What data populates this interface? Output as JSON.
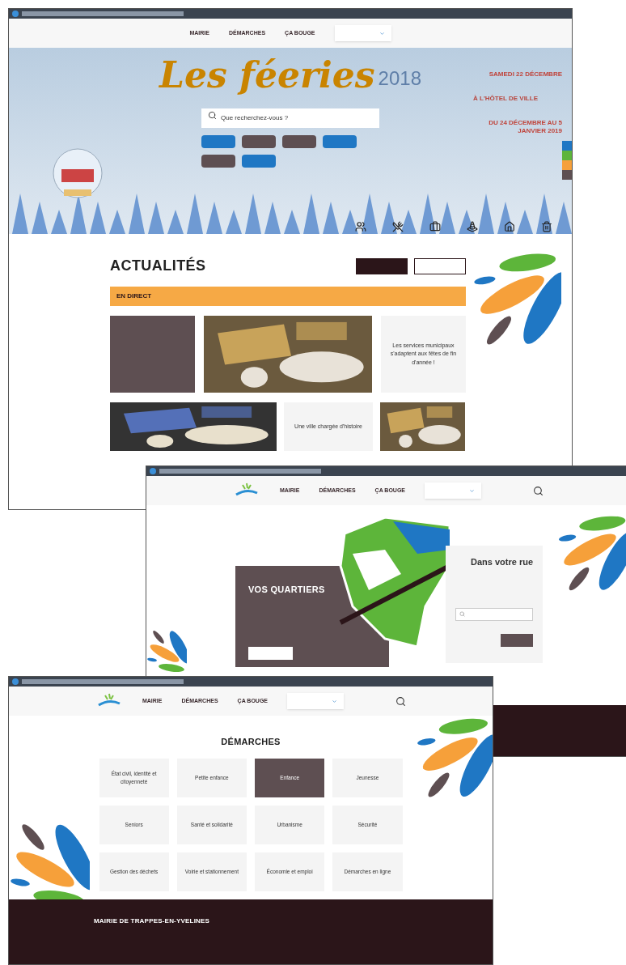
{
  "home_window": {
    "nav": [
      {
        "label": "MAIRIE"
      },
      {
        "label": "DÉMARCHES"
      },
      {
        "label": "ÇA BOUGE"
      }
    ],
    "banner": {
      "title": "Les féeries",
      "year": "2018",
      "search_placeholder": "Que recherchez-vous ?",
      "quick_buttons": [
        {
          "color": "#1f77c4"
        },
        {
          "color": "#5e4f52"
        },
        {
          "color": "#5e4f52"
        },
        {
          "color": "#1f77c4"
        },
        {
          "color": "#5e4f52"
        },
        {
          "color": "#1f77c4"
        }
      ],
      "events": [
        {
          "kind": "date",
          "text": "SAMEDI 22 DÉCEMBRE"
        },
        {
          "kind": "place",
          "text": "À L'HÔTEL DE VILLE"
        },
        {
          "kind": "date",
          "text": "DU 24 DÉCEMBRE AU 5 JANVIER 2019"
        }
      ]
    },
    "news": {
      "heading": "ACTUALITÉS",
      "ticker_label": "EN DIRECT",
      "cards": [
        {
          "kind": "dark"
        },
        {
          "kind": "picture"
        },
        {
          "kind": "text",
          "title": "Les services municipaux s'adaptent aux fêtes de fin d'année !"
        },
        {
          "kind": "picture"
        },
        {
          "kind": "text",
          "title": "Une ville chargée d'histoire"
        },
        {
          "kind": "picture"
        }
      ]
    }
  },
  "quartiers_window": {
    "nav": [
      {
        "label": "MAIRIE"
      },
      {
        "label": "DÉMARCHES"
      },
      {
        "label": "ÇA BOUGE"
      }
    ],
    "panel_title": "VOS QUARTIERS",
    "street_title": "Dans votre rue"
  },
  "demarches_window": {
    "nav": [
      {
        "label": "MAIRIE"
      },
      {
        "label": "DÉMARCHES"
      },
      {
        "label": "ÇA BOUGE"
      }
    ],
    "heading": "DÉMARCHES",
    "tiles": [
      {
        "label": "État civil, identité et citoyenneté",
        "selected": false
      },
      {
        "label": "Petite enfance",
        "selected": false
      },
      {
        "label": "Enfance",
        "selected": true
      },
      {
        "label": "Jeunesse",
        "selected": false
      },
      {
        "label": "Seniors",
        "selected": false
      },
      {
        "label": "Santé et solidarité",
        "selected": false
      },
      {
        "label": "Urbanisme",
        "selected": false
      },
      {
        "label": "Sécurité",
        "selected": false
      },
      {
        "label": "Gestion des déchets",
        "selected": false
      },
      {
        "label": "Voirie et stationnement",
        "selected": false
      },
      {
        "label": "Économie et emploi",
        "selected": false
      },
      {
        "label": "Démarches en ligne",
        "selected": false
      }
    ],
    "footer_title": "MAIRIE DE TRAPPES-EN-YVELINES"
  }
}
